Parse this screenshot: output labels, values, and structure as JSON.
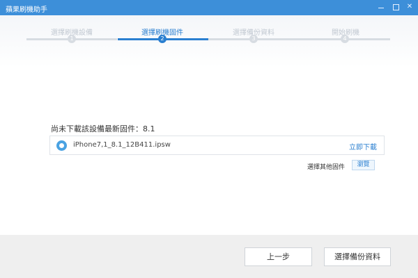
{
  "window": {
    "title": "蘋果刷機助手",
    "minimize_symbol": "",
    "maximize_symbol": "",
    "close_symbol": "✕"
  },
  "steps": [
    {
      "label": "選擇刷機設備",
      "number": "1",
      "active": false
    },
    {
      "label": "選擇刷機固件",
      "number": "2",
      "active": true
    },
    {
      "label": "選擇備份資料",
      "number": "3",
      "active": false
    },
    {
      "label": "開始刷機",
      "number": "4",
      "active": false
    }
  ],
  "firmware": {
    "message": "尚未下載該設備最新固件：8.1",
    "file_icon": "firmware-file-icon",
    "file_name": "iPhone7,1_8.1_12B411.ipsw",
    "download_label": "立即下載",
    "other_label": "選擇其他固件",
    "browse_label": "瀏覽"
  },
  "footer": {
    "prev_label": "上一步",
    "next_label": "選擇備份資料"
  },
  "colors": {
    "titlebar": "#3d8fd9",
    "accent": "#2a7fd0",
    "inactive_step": "#d7dce2",
    "footer_bg": "#efefef"
  }
}
